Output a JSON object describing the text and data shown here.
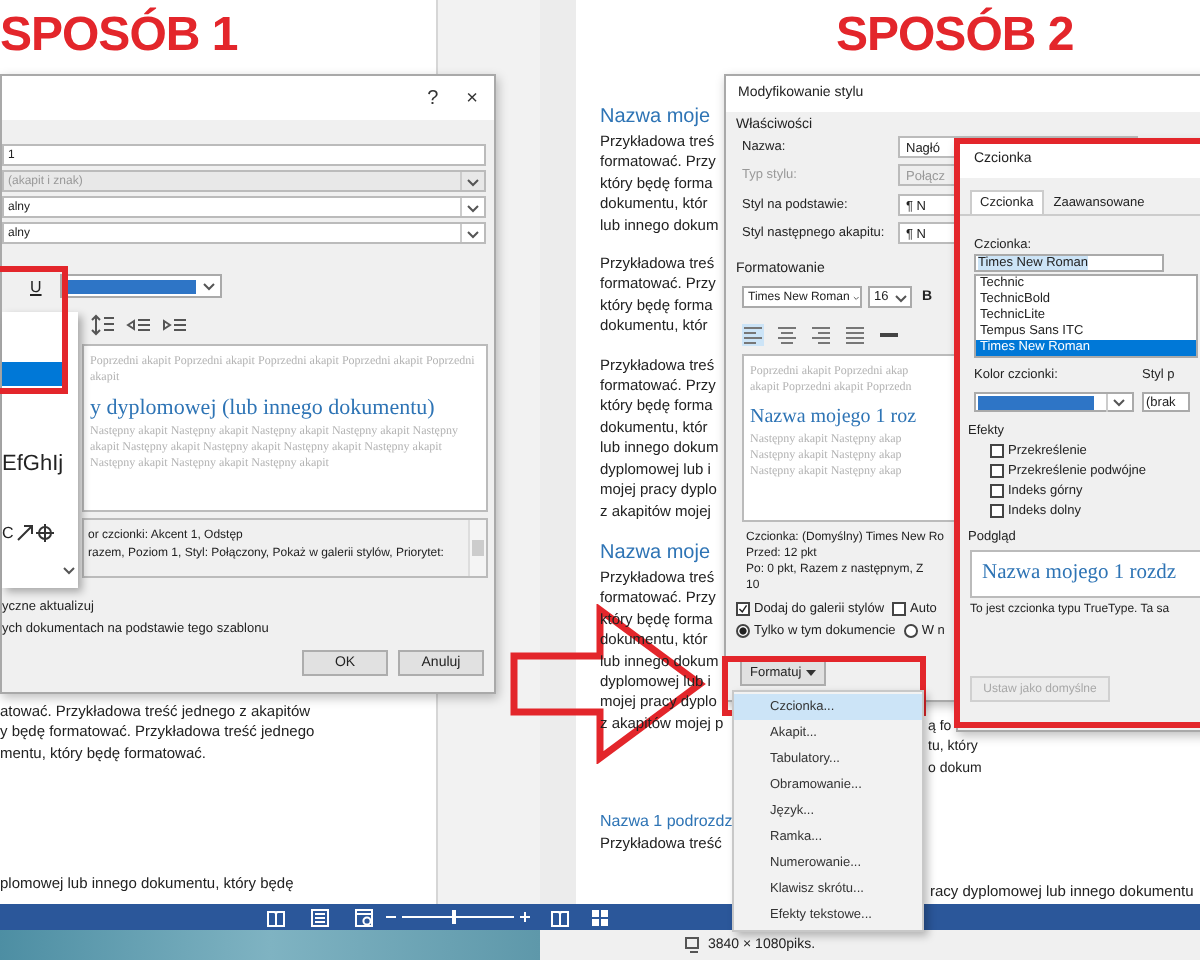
{
  "way1": {
    "caption": "SPOSÓB 1",
    "dialog": {
      "help": "?",
      "close": "×",
      "fields": [
        {
          "kind": "text",
          "value": "1",
          "disabled": false
        },
        {
          "kind": "dropdown",
          "value": "(akapit i znak)",
          "disabled": true
        },
        {
          "kind": "dropdown",
          "value": "alny",
          "disabled": false
        },
        {
          "kind": "dropdown",
          "value": "alny",
          "disabled": false
        }
      ],
      "underline": "U",
      "sample": "EfGhIj",
      "sample_2": "C",
      "preview": {
        "before": "Poprzedni akapit Poprzedni akapit Poprzedni akapit Poprzedni akapit Poprzedni akapit",
        "heading": "y dyplomowej (lub innego dokumentu)",
        "after": "Następny akapit Następny akapit Następny akapit Następny akapit Następny akapit Następny akapit Następny akapit Następny akapit Następny akapit Następny akapit Następny akapit Następny akapit"
      },
      "description": [
        "or czcionki: Akcent 1, Odstęp",
        "razem, Poziom 1, Styl: Połączony, Pokaż w galerii stylów, Priorytet:"
      ],
      "options": [
        "yczne aktualizuj",
        "ych dokumentach na podstawie tego szablonu"
      ],
      "buttons": [
        "OK",
        "Anuluj"
      ]
    },
    "document": {
      "lines": [
        "atować. Przykładowa treść jednego z akapitów",
        "y będę formatować. Przykładowa treść jednego",
        "mentu, który będę formatować."
      ],
      "bottom_line": "plomowej lub innego dokumentu, który będę"
    }
  },
  "way2": {
    "caption": "SPOSÓB 2",
    "sections": [
      {
        "heading": {
          "kind": "chapter",
          "text": "Nazwa moje"
        },
        "paragraphs": [
          [
            "Przykładowa treś",
            "formatować. Przy",
            "który będę forma",
            "dokumentu, któr",
            "lub innego dokum"
          ],
          [
            "Przykładowa treś",
            "formatować. Przy",
            "który będę forma",
            "dokumentu, któr"
          ],
          [
            "Przykładowa treś",
            "formatować. Przy",
            "który będę forma",
            "dokumentu, któr",
            "lub innego dokum",
            "dyplomowej lub i",
            "mojej pracy dyplo",
            "z akapitów mojej"
          ]
        ]
      },
      {
        "heading": {
          "kind": "chapter",
          "text": "Nazwa moje"
        },
        "paragraphs": [
          [
            "Przykładowa treś",
            "formatować. Przy",
            "który będę forma",
            "dokumentu, któr",
            "lub innego dokum",
            "dyplomowej lub i",
            "mojej pracy dyplo",
            "z akapitów mojej p"
          ]
        ]
      },
      {
        "heading": {
          "kind": "subchapter",
          "text": "Nazwa 1 podrozdz"
        },
        "paragraphs": [
          [
            "Przykładowa treść"
          ]
        ]
      }
    ],
    "fragments": [
      "ą fo",
      "tu, który",
      "o dokum"
    ],
    "last_line_right": "racy dyplomowej lub innego dokumentu",
    "modify_dialog": {
      "title": "Modyfikowanie stylu",
      "group": "Właściwości",
      "rows": [
        {
          "label": "Nazwa:",
          "value": "Nagłó",
          "disabled": false
        },
        {
          "label": "Typ stylu:",
          "value": "Połącz",
          "disabled": true
        },
        {
          "label": "Styl na podstawie:",
          "value": "¶ N",
          "disabled": false
        },
        {
          "label": "Styl następnego akapitu:",
          "value": "¶ N",
          "disabled": false
        }
      ],
      "formatting": "Formatowanie",
      "font": "Times New Roman",
      "size": "16",
      "bold": "B",
      "preview": {
        "before": [
          "Poprzedni akapit Poprzedni akap",
          "akapit Poprzedni akapit Poprzedn"
        ],
        "heading": "Nazwa mojego 1 roz",
        "after": [
          "Następny akapit Następny akap",
          "Następny akapit Następny akap",
          "Następny akapit Następny akap"
        ]
      },
      "description": [
        "Czcionka: (Domyślny) Times New Ro",
        "Przed:  12 pkt",
        "Po:  0 pkt, Razem z następnym, Z",
        "10"
      ],
      "checkboxes": [
        {
          "label": "Dodaj do galerii stylów",
          "checked": true
        },
        {
          "label": "Auto",
          "checked": false
        }
      ],
      "radios": [
        {
          "label": "Tylko w tym dokumencie",
          "selected": true
        },
        {
          "label": "W n",
          "selected": false
        }
      ],
      "format_button": "Formatuj"
    },
    "menu": [
      {
        "label": "Czcionka...",
        "selected": true
      },
      {
        "label": "Akapit...",
        "selected": false
      },
      {
        "label": "Tabulatory...",
        "selected": false
      },
      {
        "label": "Obramowanie...",
        "selected": false
      },
      {
        "label": "Język...",
        "selected": false
      },
      {
        "label": "Ramka...",
        "selected": false
      },
      {
        "label": "Numerowanie...",
        "selected": false
      },
      {
        "label": "Klawisz skrótu...",
        "selected": false
      },
      {
        "label": "Efekty tekstowe...",
        "selected": false
      }
    ],
    "font_dialog": {
      "title": "Czcionka",
      "tabs": [
        {
          "label": "Czcionka",
          "selected": true
        },
        {
          "label": "Zaawansowane",
          "selected": false
        }
      ],
      "font_label": "Czcionka:",
      "font_value": "Times New Roman",
      "fonts": [
        {
          "label": "Technic",
          "selected": false
        },
        {
          "label": "TechnicBold",
          "selected": false
        },
        {
          "label": "TechnicLite",
          "selected": false
        },
        {
          "label": "Tempus Sans ITC",
          "selected": false
        },
        {
          "label": "Times New Roman",
          "selected": true
        }
      ],
      "color_label": "Kolor czcionki:",
      "style_label": "Styl p",
      "style_value": "(brak",
      "effects_label": "Efekty",
      "effects": [
        {
          "label": "Przekreślenie",
          "checked": false
        },
        {
          "label": "Przekreślenie podwójne",
          "checked": false
        },
        {
          "label": "Indeks górny",
          "checked": false
        },
        {
          "label": "Indeks dolny",
          "checked": false
        }
      ],
      "preview_label": "Podgląd",
      "preview_text": "Nazwa mojego 1 rozdz",
      "note": "To jest czcionka typu TrueType. Ta sa",
      "default_button": {
        "label": "Ustaw jako domyślne",
        "disabled": true
      }
    },
    "status": "3840 × 1080piks."
  },
  "status_bar": {
    "zoom": {
      "level": 0.47
    }
  }
}
